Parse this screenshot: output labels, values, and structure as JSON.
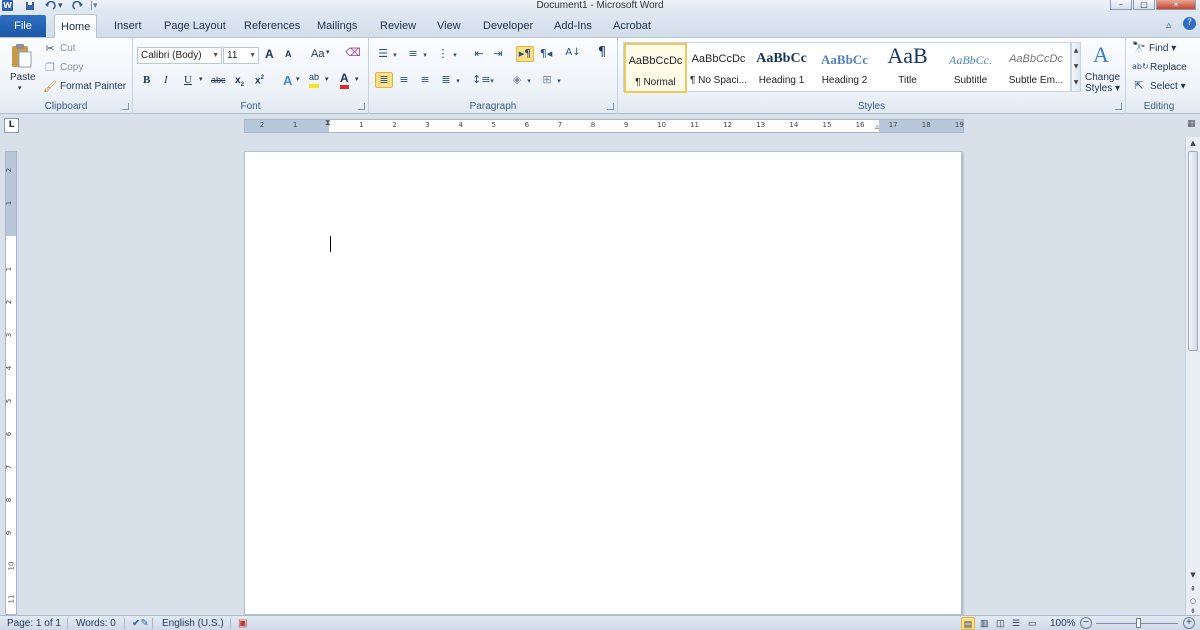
{
  "titlebar": {
    "title": "Document1 - Microsoft Word",
    "app_letter": "W",
    "undo_icon": "undo-icon",
    "redo_icon": "redo-icon",
    "save_icon": "save-icon",
    "minimize": "–",
    "maximize": "□",
    "close": "✕"
  },
  "tabs": [
    {
      "label": "File"
    },
    {
      "label": "Home"
    },
    {
      "label": "Insert"
    },
    {
      "label": "Page Layout"
    },
    {
      "label": "References"
    },
    {
      "label": "Mailings"
    },
    {
      "label": "Review"
    },
    {
      "label": "View"
    },
    {
      "label": "Developer"
    },
    {
      "label": "Add-Ins"
    },
    {
      "label": "Acrobat"
    }
  ],
  "clipboard": {
    "group_label": "Clipboard",
    "paste": "Paste",
    "cut": "Cut",
    "copy": "Copy",
    "format_painter": "Format Painter"
  },
  "font": {
    "group_label": "Font",
    "font_name": "Calibri (Body)",
    "font_size": "11",
    "grow": "A",
    "shrink": "A",
    "change_case": "Aa",
    "bold": "B",
    "italic": "I",
    "underline": "U",
    "strike": "abc",
    "subscript": "x",
    "superscript": "x",
    "effects": "A",
    "highlight": "ab",
    "color": "A"
  },
  "paragraph": {
    "group_label": "Paragraph",
    "pilcrow": "¶"
  },
  "styles": {
    "group_label": "Styles",
    "items": [
      {
        "preview": "AaBbCcDc",
        "name": "¶ Normal"
      },
      {
        "preview": "AaBbCcDc",
        "name": "¶ No Spaci..."
      },
      {
        "preview": "AaBbCc",
        "name": "Heading 1"
      },
      {
        "preview": "AaBbCc",
        "name": "Heading 2"
      },
      {
        "preview": "AaB",
        "name": "Title"
      },
      {
        "preview": "AaBbCc.",
        "name": "Subtitle"
      },
      {
        "preview": "AaBbCcDc",
        "name": "Subtle Em..."
      }
    ],
    "change_styles_line1": "Change",
    "change_styles_line2": "Styles"
  },
  "editing": {
    "group_label": "Editing",
    "find": "Find",
    "replace": "Replace",
    "select": "Select"
  },
  "ruler": {
    "tab_selector": "L",
    "h_ticks": [
      "2",
      "1",
      "1",
      "2",
      "3",
      "4",
      "5",
      "6",
      "7",
      "8",
      "9",
      "10",
      "11",
      "12",
      "13",
      "14",
      "15",
      "16",
      "17",
      "18",
      "19"
    ],
    "v_ticks": [
      "2",
      "1",
      "1",
      "2",
      "3",
      "4",
      "5",
      "6",
      "7",
      "8",
      "9",
      "10",
      "11"
    ]
  },
  "status": {
    "page": "Page: 1 of 1",
    "words": "Words: 0",
    "language": "English (U.S.)",
    "zoom": "100%",
    "zoom_minus": "−",
    "zoom_plus": "+"
  },
  "colors": {
    "accent": "#2b5fb4",
    "ribbon": "#eef3f9",
    "highlight": "#fbe18c",
    "workspace": "#d8e0ea"
  }
}
